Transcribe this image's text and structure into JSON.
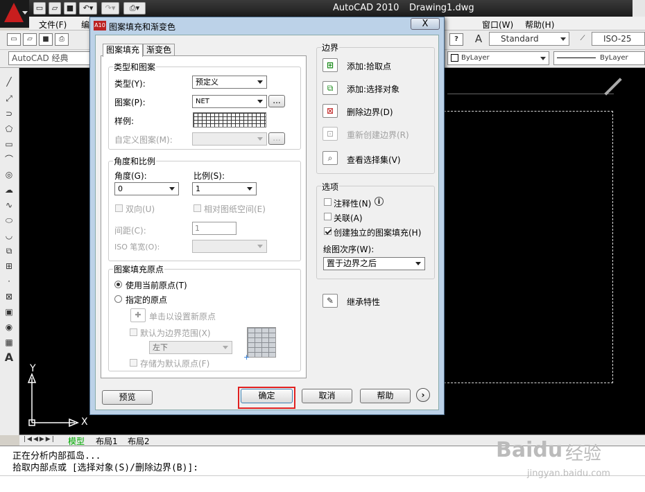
{
  "app": {
    "title": "AutoCAD 2010",
    "file": "Drawing1.dwg"
  },
  "menu": {
    "items": [
      "文件(F)",
      "编",
      "窗口(W)",
      "帮助(H)"
    ]
  },
  "toolbar1": {
    "text_style": "Standard",
    "dim_style": "ISO-25"
  },
  "toolbar2": {
    "workspace": "AutoCAD 经典",
    "color": "ByLayer",
    "linetype": "ByLayer"
  },
  "layout_tabs": [
    "模型",
    "布局1",
    "布局2"
  ],
  "command_lines": [
    "正在分析内部孤岛...",
    "拾取内部点或 [选择对象(S)/删除边界(B)]:"
  ],
  "ucs": {
    "x": "X",
    "y": "Y"
  },
  "dialog": {
    "title": "图案填充和渐变色",
    "close": "X",
    "tabs": [
      "图案填充",
      "渐变色"
    ],
    "type_pattern": {
      "group": "类型和图案",
      "type_label": "类型(Y):",
      "type_value": "预定义",
      "pattern_label": "图案(P):",
      "pattern_value": "NET",
      "browse": "...",
      "sample_label": "样例:",
      "custom_label": "自定义图案(M):",
      "custom_browse": "..."
    },
    "angle_scale": {
      "group": "角度和比例",
      "angle_label": "角度(G):",
      "angle_value": "0",
      "scale_label": "比例(S):",
      "scale_value": "1",
      "double_label": "双向(U)",
      "relative_label": "相对图纸空间(E)",
      "spacing_label": "间距(C):",
      "spacing_value": "1",
      "iso_label": "ISO 笔宽(O):"
    },
    "origin": {
      "group": "图案填充原点",
      "use_current": "使用当前原点(T)",
      "specified": "指定的原点",
      "click_set": "单击以设置新原点",
      "default_extent": "默认为边界范围(X)",
      "extent_value": "左下",
      "store_default": "存储为默认原点(F)"
    },
    "boundary": {
      "group": "边界",
      "add_pick": "添加:拾取点",
      "add_select": "添加:选择对象",
      "remove": "删除边界(D)",
      "recreate": "重新创建边界(R)",
      "view_sel": "查看选择集(V)"
    },
    "options": {
      "group": "选项",
      "annotative": "注释性(N)",
      "associative": "关联(A)",
      "independent": "创建独立的图案填充(H)",
      "draw_order_label": "绘图次序(W):",
      "draw_order_value": "置于边界之后"
    },
    "inherit": "继承特性",
    "buttons": {
      "preview": "预览",
      "ok": "确定",
      "cancel": "取消",
      "help": "帮助"
    }
  },
  "watermark": {
    "brand": "Baidu",
    "cn": "经验",
    "url": "jingyan.baidu.com"
  }
}
